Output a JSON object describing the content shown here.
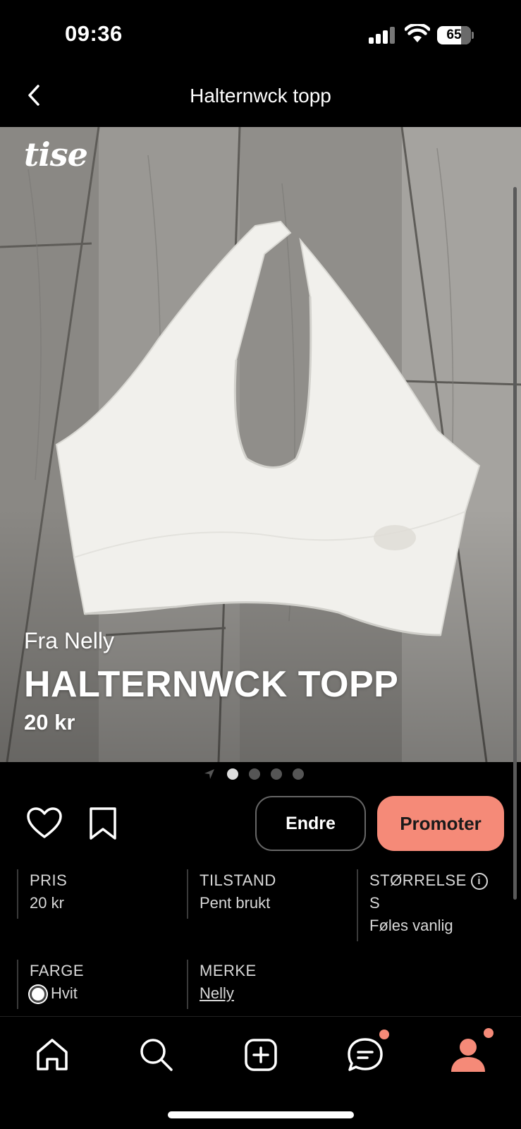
{
  "status_bar": {
    "time": "09:36",
    "battery": "65"
  },
  "header": {
    "title": "Halternwck topp"
  },
  "photo": {
    "brand_logo": "tise",
    "from_text": "Fra Nelly",
    "title": "HALTERNWCK TOPP",
    "price": "20 kr",
    "current_image": 1,
    "image_count": 4
  },
  "actions": {
    "edit_label": "Endre",
    "promote_label": "Promoter"
  },
  "details": {
    "price": {
      "label": "PRIS",
      "value": "20 kr"
    },
    "condition": {
      "label": "TILSTAND",
      "value": "Pent brukt"
    },
    "size": {
      "label": "STØRRELSE",
      "value": "S",
      "fit": "Føles vanlig"
    },
    "color": {
      "label": "FARGE",
      "value": "Hvit",
      "swatch": "#ffffff"
    },
    "brand": {
      "label": "MERKE",
      "value": "Nelly"
    }
  },
  "tabbar": {
    "items": [
      "home-icon",
      "search-icon",
      "add-icon",
      "messages-icon",
      "profile-icon"
    ],
    "accent": "#f58a78"
  },
  "colors": {
    "accent": "#f58a78",
    "background": "#000000"
  }
}
